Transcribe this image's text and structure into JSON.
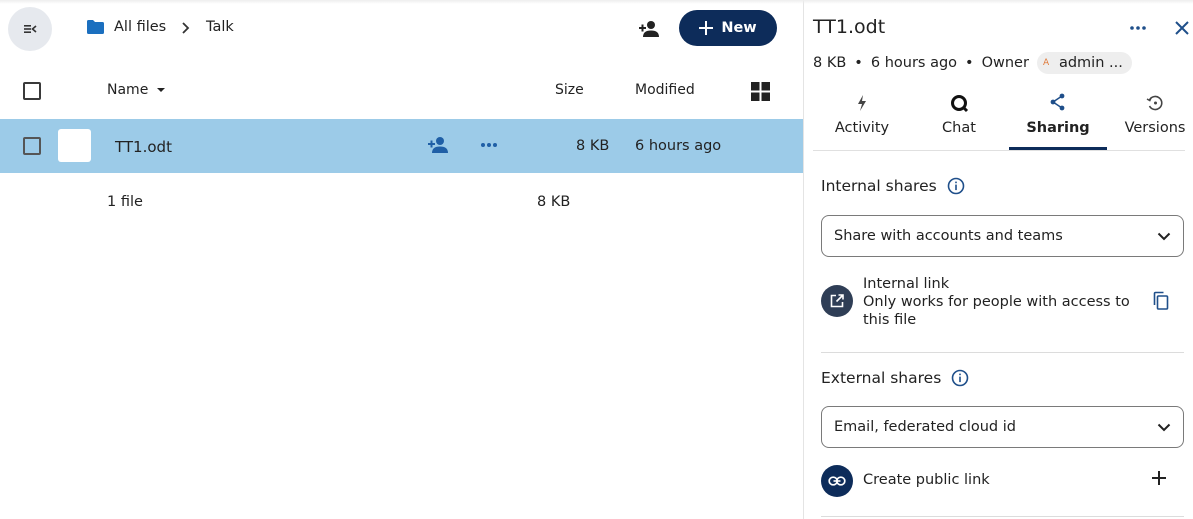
{
  "breadcrumb": {
    "root": "All files",
    "current": "Talk"
  },
  "toolbar": {
    "new_label": "New"
  },
  "table": {
    "headers": {
      "name": "Name",
      "size": "Size",
      "modified": "Modified"
    },
    "rows": [
      {
        "name": "TT1.odt",
        "size": "8 KB",
        "modified": "6 hours ago",
        "selected": true
      }
    ],
    "summary": {
      "count": "1 file",
      "size": "8 KB"
    }
  },
  "sidebar": {
    "title": "TT1.odt",
    "meta": {
      "size": "8 KB",
      "time": "6 hours ago",
      "owner_label": "Owner",
      "owner_name": "admin ...",
      "owner_initial": "A"
    },
    "tabs": [
      {
        "label": "Activity",
        "icon": "activity-icon"
      },
      {
        "label": "Chat",
        "icon": "chat-icon"
      },
      {
        "label": "Sharing",
        "icon": "share-icon",
        "active": true
      },
      {
        "label": "Versions",
        "icon": "history-icon"
      }
    ],
    "internal": {
      "title": "Internal shares",
      "select_placeholder": "Share with accounts and teams",
      "link_title": "Internal link",
      "link_desc": "Only works for people with access to this file"
    },
    "external": {
      "title": "External shares",
      "select_placeholder": "Email, federated cloud id",
      "public_link_label": "Create public link"
    }
  },
  "colors": {
    "accent": "#0d2c5a",
    "selected_row": "#9ccbe8",
    "folder": "#1b6fbf",
    "owner_avatar": "#e07a3a"
  }
}
